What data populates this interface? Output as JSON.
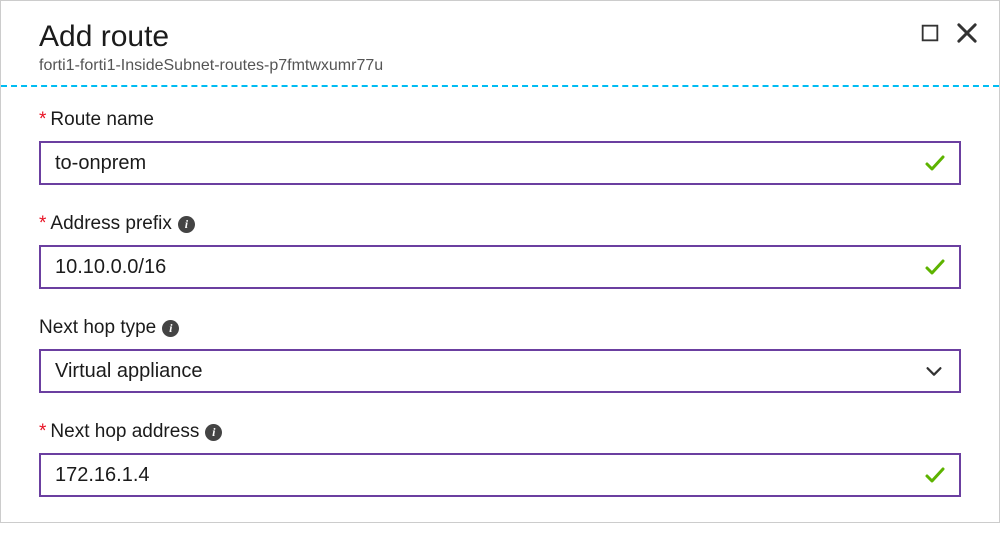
{
  "header": {
    "title": "Add route",
    "subtitle": "forti1-forti1-InsideSubnet-routes-p7fmtwxumr77u"
  },
  "fields": {
    "route_name": {
      "label": "Route name",
      "value": "to-onprem",
      "required": true,
      "valid": true
    },
    "address_prefix": {
      "label": "Address prefix",
      "value": "10.10.0.0/16",
      "required": true,
      "valid": true
    },
    "next_hop_type": {
      "label": "Next hop type",
      "value": "Virtual appliance",
      "required": false
    },
    "next_hop_address": {
      "label": "Next hop address",
      "value": "172.16.1.4",
      "required": true,
      "valid": true
    }
  },
  "colors": {
    "border": "#6b3fa0",
    "required": "#e81123",
    "divider": "#00bcf2",
    "success": "#5db300"
  }
}
